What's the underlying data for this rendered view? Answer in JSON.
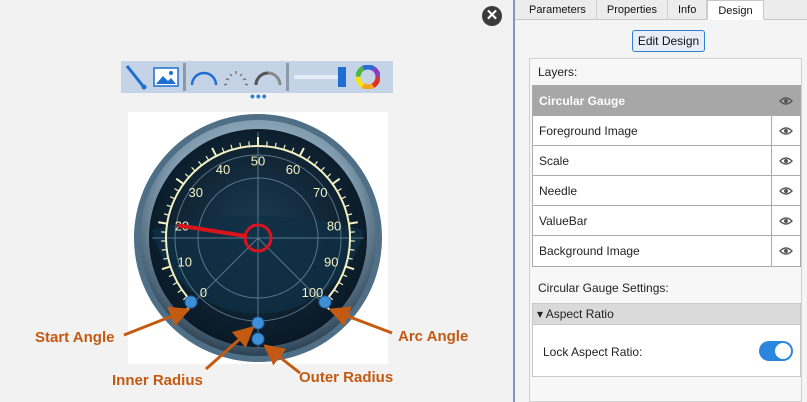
{
  "canvas": {
    "callouts": {
      "start_angle": "Start Angle",
      "inner_radius": "Inner Radius",
      "outer_radius": "Outer Radius",
      "arc_angle": "Arc Angle"
    },
    "more_dots": "•••",
    "close_glyph": "✕"
  },
  "gauge": {
    "scale_labels": [
      "0",
      "10",
      "20",
      "30",
      "40",
      "50",
      "60",
      "70",
      "80",
      "90",
      "100"
    ],
    "needle_value": 20
  },
  "toolbar": {
    "items": [
      "needle-tool-icon",
      "image-tool-icon",
      "arc-scale-icon",
      "tick-scale-icon",
      "value-arc-icon",
      "valuebar-icon",
      "color-wheel-icon"
    ]
  },
  "panel": {
    "tabs": [
      "Parameters",
      "Properties",
      "Info",
      "Design"
    ],
    "active_tab": "Design",
    "edit_design": "Edit Design",
    "layers_label": "Layers:",
    "layers": [
      "Circular Gauge",
      "Foreground Image",
      "Scale",
      "Needle",
      "ValueBar",
      "Background Image"
    ],
    "settings_label": "Circular Gauge Settings:",
    "aspect_ratio_label": "Aspect Ratio",
    "aspect_arrow": "▾",
    "lock_aspect_label": "Lock Aspect Ratio:",
    "lock_aspect_value": true
  },
  "colors": {
    "accent": "#2b86e0",
    "callout": "#c45a12",
    "gauge_face": "#0c2233",
    "needle": "#d9141c"
  }
}
